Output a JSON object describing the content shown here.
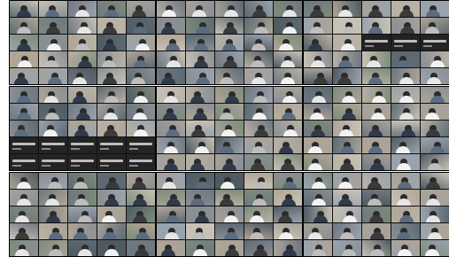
{
  "frames": [
    {
      "id": "top-left"
    },
    {
      "id": "top-center"
    },
    {
      "id": "top-right"
    },
    {
      "id": "middle-left"
    },
    {
      "id": "middle-center"
    },
    {
      "id": "middle-right"
    },
    {
      "id": "bottom-left"
    },
    {
      "id": "bottom-center"
    },
    {
      "id": "bottom-right"
    }
  ],
  "colors": {
    "background": "#ffffff",
    "frame_border": "#111111",
    "name_only_tile": "#242424"
  }
}
